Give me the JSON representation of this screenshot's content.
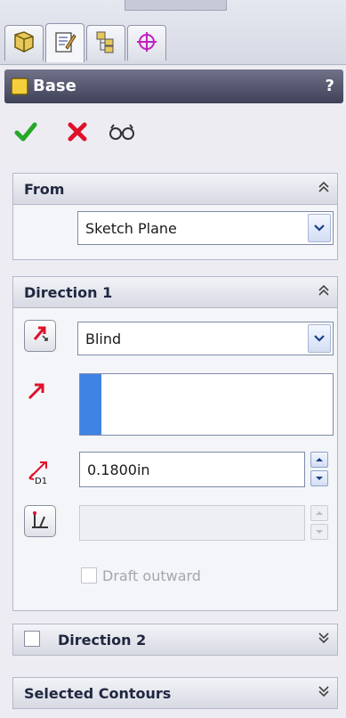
{
  "tabs": [
    {
      "icon": "feature-manager-icon",
      "active": false
    },
    {
      "icon": "property-manager-icon",
      "active": true
    },
    {
      "icon": "configuration-manager-icon",
      "active": false
    },
    {
      "icon": "dimxpert-manager-icon",
      "active": false
    }
  ],
  "title": {
    "label": "Base",
    "help": "?"
  },
  "actions": {
    "ok": "ok-check-icon",
    "cancel": "cancel-x-icon",
    "preview": "detailed-preview-icon"
  },
  "from": {
    "title": "From",
    "value": "Sketch Plane"
  },
  "direction1": {
    "title": "Direction 1",
    "end_condition": "Blind",
    "depth": "0.1800in",
    "draft_value": "",
    "draft_outward": "Draft outward",
    "draft_outward_checked": false
  },
  "direction2": {
    "title": "Direction 2",
    "checked": false
  },
  "selected_contours": {
    "title": "Selected Contours"
  },
  "colors": {
    "accent": "#3f83e4",
    "title_bar": "#4a4d62",
    "arrow_red": "#e0102a"
  }
}
